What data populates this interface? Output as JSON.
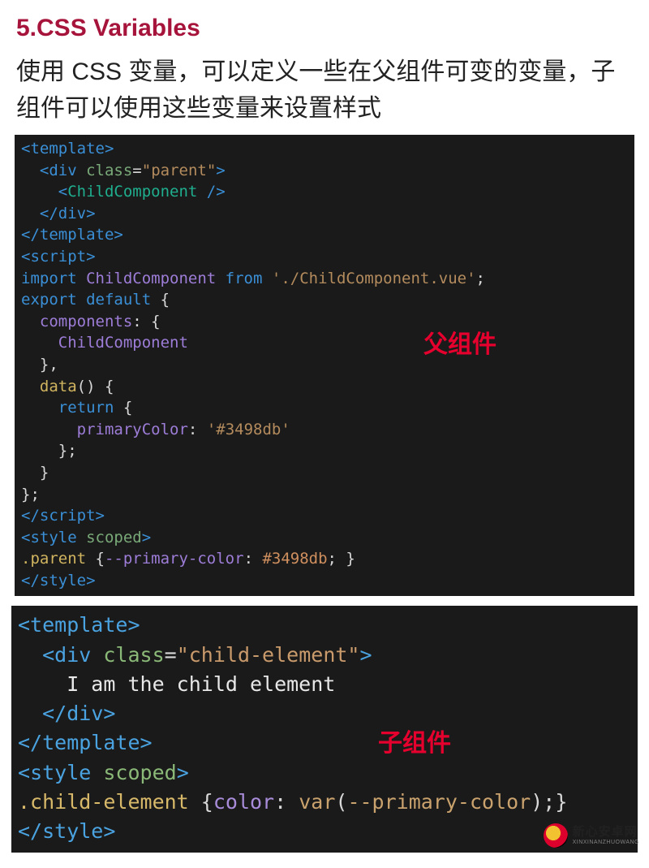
{
  "heading": "5.CSS Variables",
  "description": "使用 CSS 变量，可以定义一些在父组件可变的变量，子组件可以使用这些变量来设置样式",
  "labels": {
    "parent": "父组件",
    "child": "子组件"
  },
  "code1": {
    "l1a": "<template>",
    "l2a": "  <",
    "l2b": "div ",
    "l2c": "class",
    "l2d": "=",
    "l2e": "\"parent\"",
    "l2f": ">",
    "l3a": "    <",
    "l3b": "ChildComponent ",
    "l3c": "/>",
    "l4a": "  </",
    "l4b": "div",
    "l4c": ">",
    "l5a": "</template>",
    "l6a": "<script>",
    "l7a": "import ",
    "l7b": "ChildComponent ",
    "l7c": "from ",
    "l7d": "'./ChildComponent.vue'",
    "l7e": ";",
    "l8a": "export ",
    "l8b": "default ",
    "l8c": "{",
    "l9a": "  components",
    "l9b": ": {",
    "l10a": "    ChildComponent",
    "l11a": "  },",
    "l12a": "  ",
    "l12b": "data",
    "l12c": "() {",
    "l13a": "    ",
    "l13b": "return ",
    "l13c": "{",
    "l14a": "      ",
    "l14b": "primaryColor",
    "l14c": ": ",
    "l14d": "'#3498db'",
    "l15a": "    };",
    "l16a": "  }",
    "l17a": "};",
    "l18a": "</script>",
    "l19a": "<",
    "l19b": "style ",
    "l19c": "scoped",
    "l19d": ">",
    "l20a": ".parent ",
    "l20b": "{",
    "l20c": "--primary-color",
    "l20d": ": ",
    "l20e": "#3498db",
    "l20f": "; }",
    "l21a": "</style>"
  },
  "code2": {
    "l1a": "<template>",
    "l2a": "  <",
    "l2b": "div ",
    "l2c": "class",
    "l2d": "=",
    "l2e": "\"child-element\"",
    "l2f": ">",
    "l3a": "    I am the child element",
    "l4a": "  </",
    "l4b": "div",
    "l4c": ">",
    "l5a": "</template>",
    "l6a": "<",
    "l6b": "style ",
    "l6c": "scoped",
    "l6d": ">",
    "l7a": ".child-element ",
    "l7b": "{",
    "l7c": "color",
    "l7d": ": ",
    "l7e": "var",
    "l7f": "(",
    "l7g": "--primary-color",
    "l7h": ");}",
    "l8a": "</style>"
  },
  "watermark": {
    "cn": "新心安卓网",
    "en": "XINXINANZHUOWANG"
  }
}
